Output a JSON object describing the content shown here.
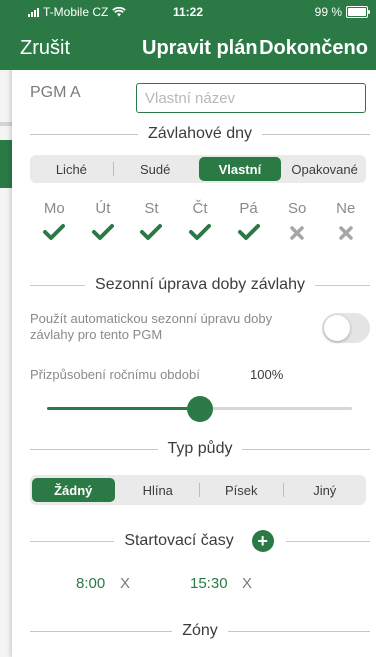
{
  "status": {
    "carrier": "T-Mobile CZ",
    "time": "11:22",
    "battery": "99 %",
    "battery_level": 0.99
  },
  "nav": {
    "left": "Zrušit",
    "title": "Upravit plán",
    "right": "Dokončeno"
  },
  "name": {
    "label": "PGM A",
    "placeholder": "Vlastní název",
    "value": ""
  },
  "sections": {
    "irrigation_days": "Závlahové dny",
    "seasonal": "Sezonní úprava doby závlahy",
    "soil": "Typ půdy",
    "start_times": "Startovací časy",
    "zones": "Zóny"
  },
  "day_mode": {
    "options": [
      "Liché",
      "Sudé",
      "Vlastní",
      "Opakované"
    ],
    "selected": 2
  },
  "days": [
    {
      "label": "Mo",
      "on": true
    },
    {
      "label": "Út",
      "on": true
    },
    {
      "label": "St",
      "on": true
    },
    {
      "label": "Čt",
      "on": true
    },
    {
      "label": "Pá",
      "on": true
    },
    {
      "label": "So",
      "on": false
    },
    {
      "label": "Ne",
      "on": false
    }
  ],
  "auto_adjust": {
    "text": "Použít automatickou sezonní úpravu doby závlahy pro tento PGM",
    "on": false
  },
  "seasonal": {
    "label": "Přizpůsobení ročnímu období",
    "value": "100%",
    "level": 0.5
  },
  "soil": {
    "options": [
      "Žádný",
      "Hlína",
      "Písek",
      "Jiný"
    ],
    "selected": 0
  },
  "start_times": [
    {
      "time": "8:00",
      "remove": "X"
    },
    {
      "time": "15:30",
      "remove": "X"
    }
  ],
  "colors": {
    "accent": "#2b7a46",
    "muted": "#8a8a8a",
    "off_mark": "#a6a6a6"
  }
}
